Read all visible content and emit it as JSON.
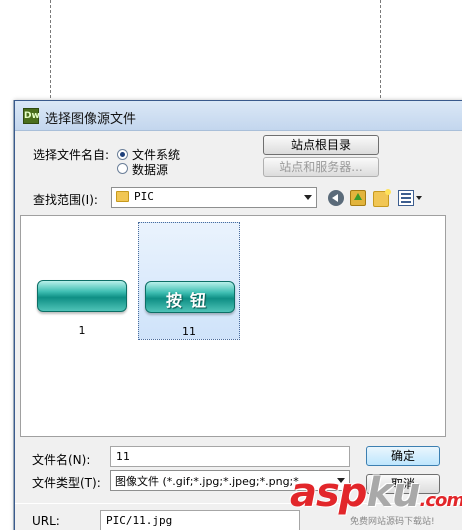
{
  "window": {
    "title": "选择图像源文件",
    "app_badge": "Dw"
  },
  "select_from": {
    "label": "选择文件名自:",
    "options": [
      {
        "label": "文件系统",
        "selected": true
      },
      {
        "label": "数据源",
        "selected": false
      }
    ]
  },
  "buttons": {
    "site_root": "站点根目录",
    "sites_servers": "站点和服务器...",
    "ok": "确定",
    "cancel": "取消"
  },
  "lookin": {
    "label": "查找范围(I):",
    "value": "PIC"
  },
  "toolbar_icons": [
    "back-icon",
    "up-folder-icon",
    "new-folder-icon",
    "views-menu-icon"
  ],
  "files": [
    {
      "name": "1",
      "selected": false,
      "image_text": ""
    },
    {
      "name": "11",
      "selected": true,
      "image_text": "按钮"
    }
  ],
  "filename": {
    "label": "文件名(N):",
    "value": "11"
  },
  "filetype": {
    "label": "文件类型(T):",
    "value": "图像文件 (*.gif;*.jpg;*.jpeg;*.png;*"
  },
  "url": {
    "label": "URL:",
    "value": "PIC/11.jpg"
  },
  "watermark": {
    "brand_main": "asp",
    "brand_k": "ku",
    "brand_tail": ".com",
    "tagline": "免费网站源码下载站!"
  },
  "colors": {
    "title_bar": "#c3d6ee",
    "selection": "#cfe3fa",
    "button_teal": "#0e8f84",
    "watermark_red": "#e2262a"
  }
}
